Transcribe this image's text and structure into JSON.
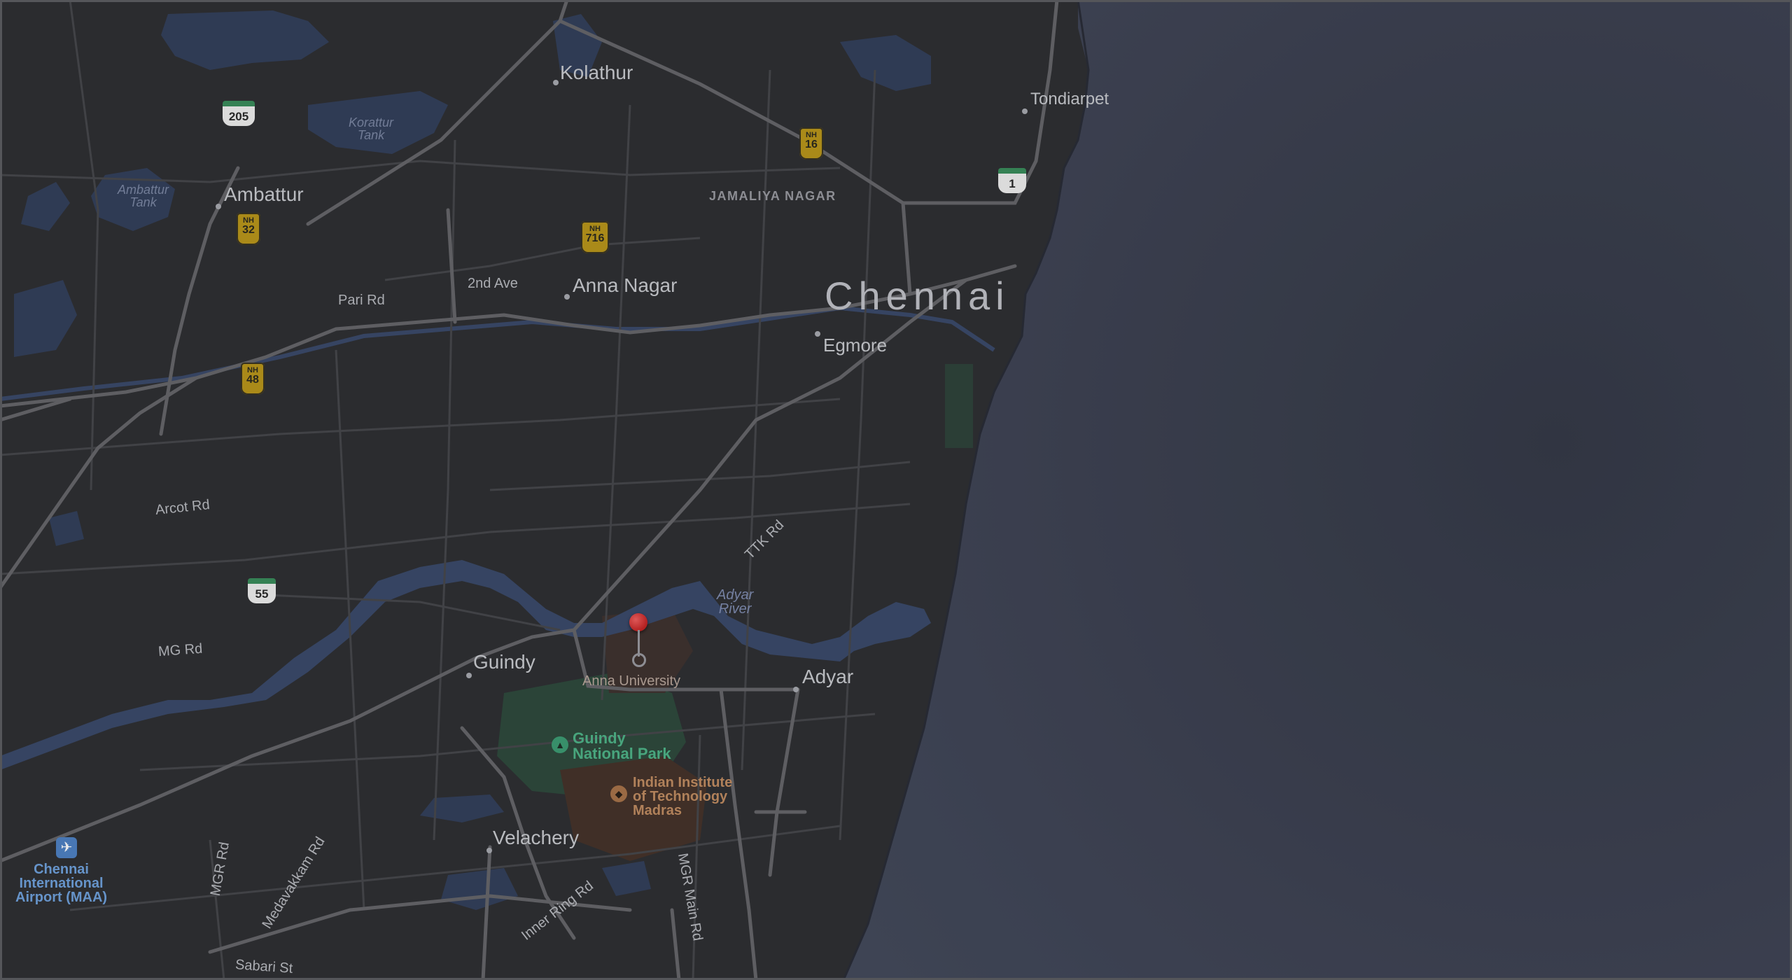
{
  "map": {
    "city": "Chennai",
    "localities": {
      "kolathur": "Kolathur",
      "tondiarpet": "Tondiarpet",
      "ambattur": "Ambattur",
      "anna_nagar": "Anna Nagar",
      "egmore": "Egmore",
      "guindy": "Guindy",
      "adyar": "Adyar",
      "velachery": "Velachery"
    },
    "districts": {
      "jamaliya_nagar": "JAMALIYA NAGAR"
    },
    "water": {
      "korattur_tank": [
        "Korattur",
        "Tank"
      ],
      "ambattur_tank": [
        "Ambattur",
        "Tank"
      ],
      "adyar_river": [
        "Adyar",
        "River"
      ]
    },
    "roads": {
      "pari_rd": "Pari Rd",
      "second_ave": "2nd Ave",
      "arcot_rd": "Arcot Rd",
      "ttk_rd": "TTK Rd",
      "mg_rd": "MG Rd",
      "mgr_rd": "MGR Rd",
      "medavakkam_rd": "Medavakkam Rd",
      "inner_ring_rd": "Inner Ring Rd",
      "mgr_main_rd": "MGR Main Rd",
      "sabari_st": "Sabari St"
    },
    "shields": {
      "nh_label": "NH",
      "nh16": "16",
      "nh32": "32",
      "nh716": "716",
      "nh48": "48",
      "sh205": "205",
      "sh1": "1",
      "sh55": "55"
    },
    "pois": {
      "airport": [
        "Chennai",
        "International",
        "Airport (MAA)"
      ],
      "guindy_park": [
        "Guindy",
        "National Park"
      ],
      "iit": [
        "Indian Institute",
        "of Technology",
        "Madras"
      ],
      "dropped_pin": "Anna University"
    },
    "colors": {
      "land": "#2f3034",
      "sea": "#3a3f4e",
      "water_body": "#3b4a6b",
      "major_road": "#66676b",
      "minor_road": "#47484c",
      "nh_shield": "#b9961c",
      "sh_shield_band": "#3a8c5c",
      "park": "#2f4a3d",
      "campus": "#46342b",
      "pin": "#d43a3a"
    },
    "icons": {
      "airport": "airplane-icon",
      "park": "tree-icon",
      "iit": "graduation-cap-icon",
      "pin": "map-pin-icon"
    }
  }
}
